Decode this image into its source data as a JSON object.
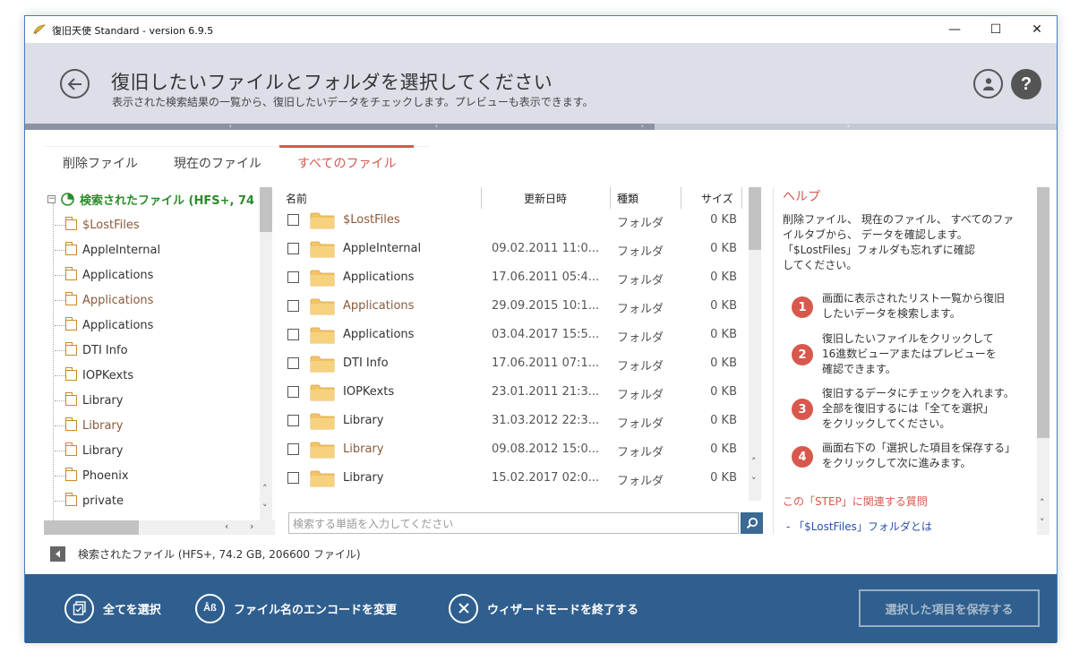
{
  "window": {
    "title": "復旧天使 Standard - version 6.9.5",
    "controls": {
      "minimize": "—",
      "maximize": "☐",
      "close": "✕"
    }
  },
  "header": {
    "title": "復旧したいファイルとフォルダを選択してください",
    "subtitle": "表示された検索結果の一覧から、復旧したいデータをチェックします。プレビューも表示できます。",
    "progress_fraction": 0.61
  },
  "tabs": [
    {
      "label": "削除ファイル"
    },
    {
      "label": "現在のファイル"
    },
    {
      "label": "すべてのファイル",
      "active": true
    }
  ],
  "tree": {
    "root_label": "検索されたファイル (HFS+, 74",
    "items": [
      {
        "label": "$LostFiles",
        "brown": true
      },
      {
        "label": "AppleInternal",
        "brown": false
      },
      {
        "label": "Applications",
        "brown": false
      },
      {
        "label": "Applications",
        "brown": true
      },
      {
        "label": "Applications",
        "brown": false
      },
      {
        "label": "DTI Info",
        "brown": false
      },
      {
        "label": "IOPKexts",
        "brown": false
      },
      {
        "label": "Library",
        "brown": false
      },
      {
        "label": "Library",
        "brown": true
      },
      {
        "label": "Library",
        "brown": false
      },
      {
        "label": "Phoenix",
        "brown": false
      },
      {
        "label": "private",
        "brown": false
      }
    ]
  },
  "list": {
    "headers": {
      "name": "名前",
      "date": "更新日時",
      "type": "種類",
      "size": "サイズ"
    },
    "rows": [
      {
        "name": "$LostFiles",
        "date": "",
        "type": "フォルダ",
        "size": "0 KB",
        "brown": true
      },
      {
        "name": "AppleInternal",
        "date": "09.02.2011 11:0...",
        "type": "フォルダ",
        "size": "0 KB",
        "brown": false
      },
      {
        "name": "Applications",
        "date": "17.06.2011 05:4...",
        "type": "フォルダ",
        "size": "0 KB",
        "brown": false
      },
      {
        "name": "Applications",
        "date": "29.09.2015 10:1...",
        "type": "フォルダ",
        "size": "0 KB",
        "brown": true
      },
      {
        "name": "Applications",
        "date": "03.04.2017 15:5...",
        "type": "フォルダ",
        "size": "0 KB",
        "brown": false
      },
      {
        "name": "DTI Info",
        "date": "17.06.2011 07:1...",
        "type": "フォルダ",
        "size": "0 KB",
        "brown": false
      },
      {
        "name": "IOPKexts",
        "date": "23.01.2011 21:3...",
        "type": "フォルダ",
        "size": "0 KB",
        "brown": false
      },
      {
        "name": "Library",
        "date": "31.03.2012 22:3...",
        "type": "フォルダ",
        "size": "0 KB",
        "brown": false
      },
      {
        "name": "Library",
        "date": "09.08.2012 15:0...",
        "type": "フォルダ",
        "size": "0 KB",
        "brown": true
      },
      {
        "name": "Library",
        "date": "15.02.2017 02:0...",
        "type": "フォルダ",
        "size": "0 KB",
        "brown": false
      }
    ]
  },
  "search": {
    "placeholder": "検索する単語を入力してください"
  },
  "help": {
    "title": "ヘルプ",
    "intro": [
      "削除ファイル、 現在のファイル、 すべてのファ",
      "イルタブから、 データを確認します。",
      "「$LostFiles」フォルダも忘れずに確認",
      "してください。"
    ],
    "steps": [
      {
        "num": "1",
        "lines": [
          "画面に表示されたリスト一覧から復旧",
          "したいデータを検索します。"
        ]
      },
      {
        "num": "2",
        "lines": [
          "復旧したいファイルをクリックして",
          "16進数ビューアまたはプレビューを",
          "確認できます。"
        ]
      },
      {
        "num": "3",
        "lines": [
          "復旧するデータにチェックを入れます。",
          "全部を復旧するには「全てを選択」",
          "をクリックしてください。"
        ]
      },
      {
        "num": "4",
        "lines": [
          "画面右下の「選択した項目を保存する」",
          "をクリックして次に進みます。"
        ]
      }
    ],
    "faq_title": "この「STEP」に関連する質問",
    "faq_item": "- 「$LostFiles」フォルダとは"
  },
  "status": {
    "text": "検索されたファイル (HFS+, 74.2 GB, 206600 ファイル)"
  },
  "bottom": {
    "select_all": "全てを選択",
    "change_encoding": "ファイル名のエンコードを変更",
    "exit_wizard": "ウィザードモードを終了する",
    "save_selected": "選択した項目を保存する"
  },
  "colors": {
    "accent": "#d8584d",
    "bottom_bar": "#2f5f8f",
    "tree_root": "#2a8c2a",
    "brown_text": "#8a5a3a",
    "link": "#2b4fa8"
  }
}
